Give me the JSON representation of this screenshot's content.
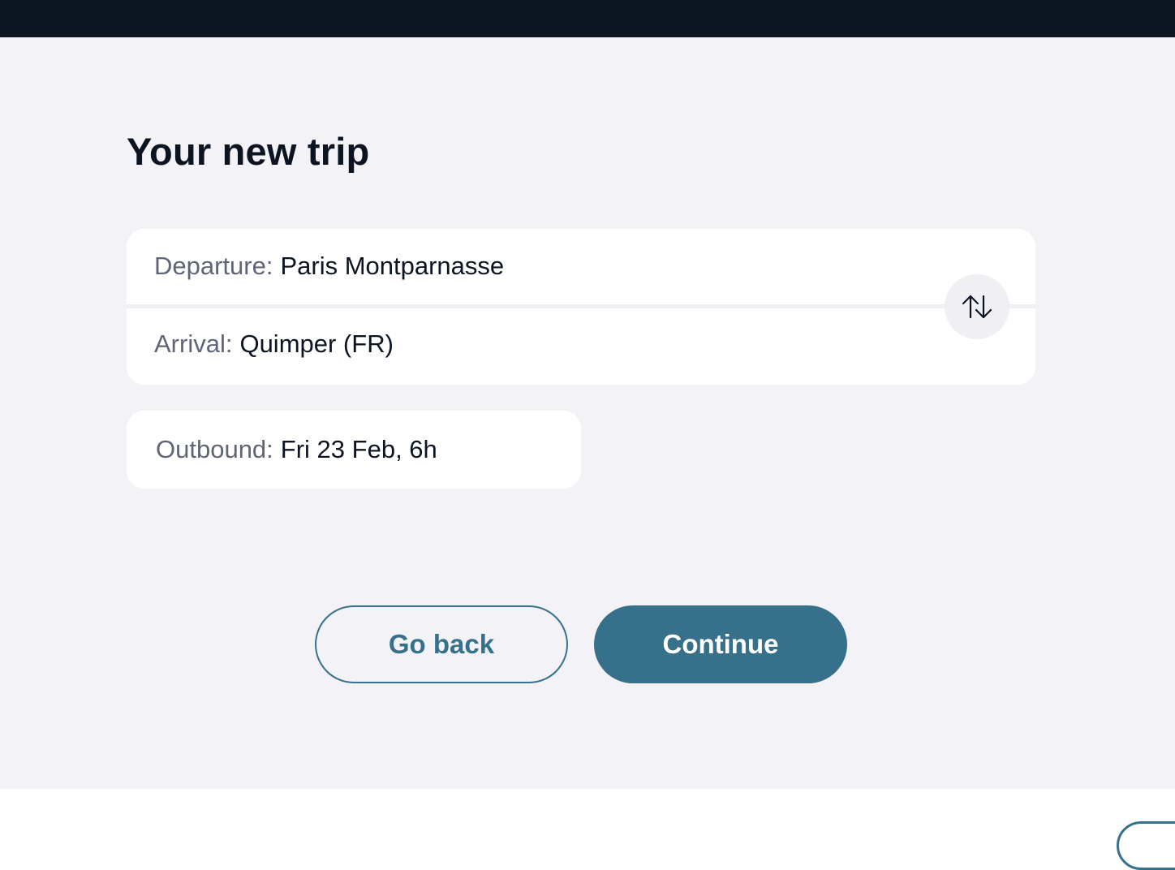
{
  "page": {
    "title": "Your new trip"
  },
  "route": {
    "departure": {
      "label": "Departure:",
      "value": "Paris Montparnasse"
    },
    "arrival": {
      "label": "Arrival:",
      "value": "Quimper (FR)"
    },
    "swap_icon": "swap-vertical-arrows-icon"
  },
  "outbound": {
    "label": "Outbound:",
    "value": "Fri 23 Feb, 6h"
  },
  "actions": {
    "back_label": "Go back",
    "continue_label": "Continue"
  },
  "colors": {
    "top_bar": "#0c1421",
    "background": "#f3f3f7",
    "card": "#ffffff",
    "accent": "#36708a",
    "label_text": "#5f6576",
    "value_text": "#0c1421"
  }
}
